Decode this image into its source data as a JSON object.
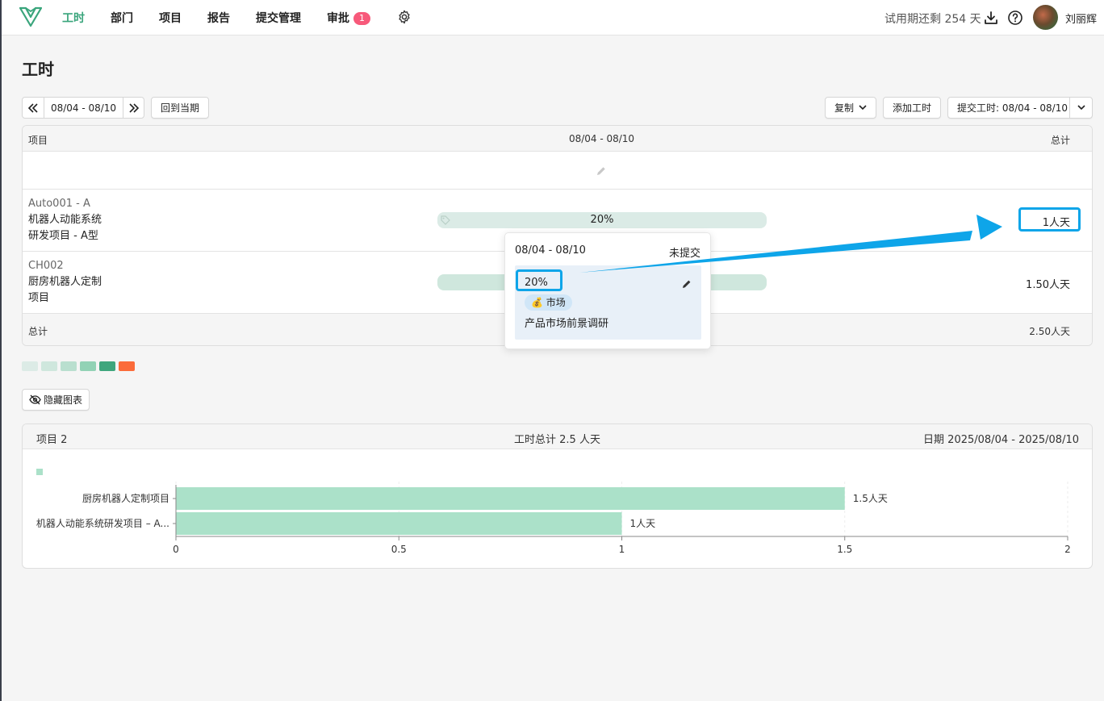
{
  "nav": {
    "items": [
      {
        "label": "工时",
        "active": true
      },
      {
        "label": "部门"
      },
      {
        "label": "项目"
      },
      {
        "label": "报告"
      },
      {
        "label": "提交管理"
      },
      {
        "label": "审批"
      }
    ],
    "approval_badge": "1",
    "trial_text": "试用期还剩 254 天",
    "username": "刘丽辉"
  },
  "page": {
    "title": "工时"
  },
  "toolbar": {
    "prev_icon": "double-chevron-left-icon",
    "period": "08/04 - 08/10",
    "next_icon": "double-chevron-right-icon",
    "back_current": "回到当期",
    "copy": "复制",
    "add": "添加工时",
    "submit": "提交工时: 08/04 - 08/10"
  },
  "table": {
    "headers": {
      "project": "项目",
      "period": "08/04 - 08/10",
      "total": "总计"
    },
    "rows": [
      {
        "code": "Auto001 - A",
        "name_line1": "机器人动能系统",
        "name_line2": "研发项目 - A型",
        "percent": "20%",
        "total": "1人天"
      },
      {
        "code": "CH002",
        "name_line1": "厨房机器人定制",
        "name_line2": "项目",
        "percent": "",
        "total": "1.50人天"
      }
    ],
    "footer": {
      "label": "总计",
      "total": "2.50人天"
    }
  },
  "legend_colors": [
    "#dcebe6",
    "#cfe7dd",
    "#b9dfcf",
    "#92d2b5",
    "#3fa67d",
    "#fb6b3a"
  ],
  "popup": {
    "period": "08/04 - 08/10",
    "status": "未提交",
    "percent": "20%",
    "tag_icon": "money-bag-icon",
    "tag": "市场",
    "description": "产品市场前景调研"
  },
  "chart_toggle": {
    "label": "隐藏图表",
    "icon": "eye-off-icon"
  },
  "chart_card": {
    "left": "项目 2",
    "center": "工时总计 2.5 人天",
    "right": "日期 2025/08/04 - 2025/08/10"
  },
  "chart_data": {
    "type": "bar",
    "orientation": "horizontal",
    "categories": [
      "厨房机器人定制项目",
      "机器人动能系统研发项目 – A..."
    ],
    "values": [
      1.5,
      1
    ],
    "value_labels": [
      "1.5人天",
      "1人天"
    ],
    "xlim": [
      0,
      2
    ],
    "xticks": [
      "0",
      "0.5",
      "1",
      "1.5",
      "2"
    ],
    "bar_color": "#abe1c9",
    "grid": true
  },
  "colors": {
    "accent": "#3aa57c",
    "highlight": "#0ea5e9",
    "badge": "#f7597a"
  }
}
